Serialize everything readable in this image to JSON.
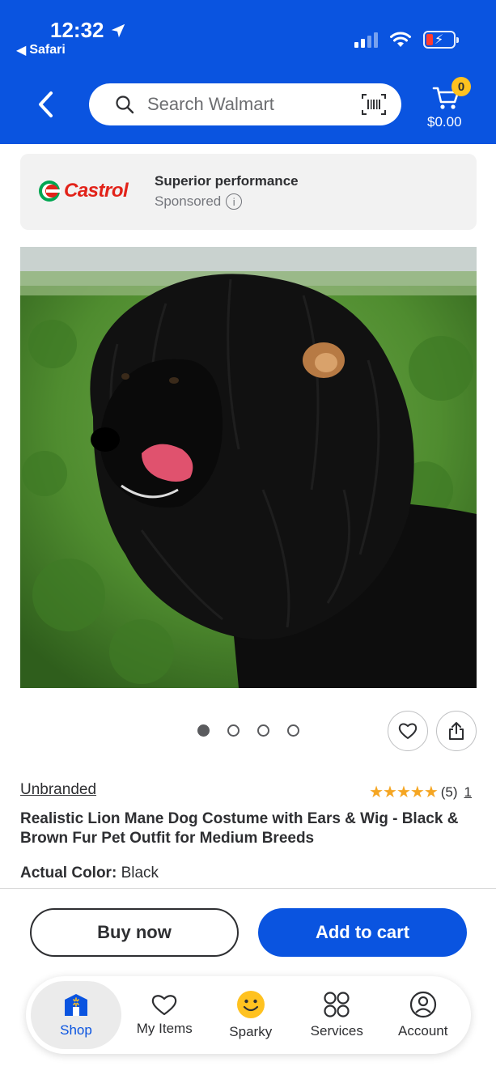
{
  "status_bar": {
    "time": "12:32",
    "back_app": "Safari"
  },
  "header": {
    "search_placeholder": "Search Walmart",
    "cart_count": "0",
    "cart_total": "$0.00",
    "brand_color": "#0a54e0",
    "badge_color": "#ffc220"
  },
  "ad": {
    "brand": "Castrol",
    "headline": "Superior performance",
    "sponsored_label": "Sponsored",
    "info_glyph": "i"
  },
  "carousel": {
    "total_images": 4,
    "active_index": 0
  },
  "product": {
    "brand": "Unbranded",
    "stars": "★★★★★",
    "rating_count": "(5)",
    "rating_link": "1",
    "title": "Realistic Lion Mane Dog Costume with Ears & Wig - Black & Brown Fur Pet Outfit for Medium Breeds",
    "color_label": "Actual Color:",
    "color_value": "Black"
  },
  "actions": {
    "buy_now": "Buy now",
    "add_to_cart": "Add to cart"
  },
  "bottom_nav": {
    "items": [
      {
        "label": "Shop",
        "icon": "store-icon",
        "active": true
      },
      {
        "label": "My Items",
        "icon": "heart-icon",
        "active": false
      },
      {
        "label": "Sparky",
        "icon": "sparky-icon",
        "active": false
      },
      {
        "label": "Services",
        "icon": "services-icon",
        "active": false
      },
      {
        "label": "Account",
        "icon": "account-icon",
        "active": false
      }
    ]
  }
}
